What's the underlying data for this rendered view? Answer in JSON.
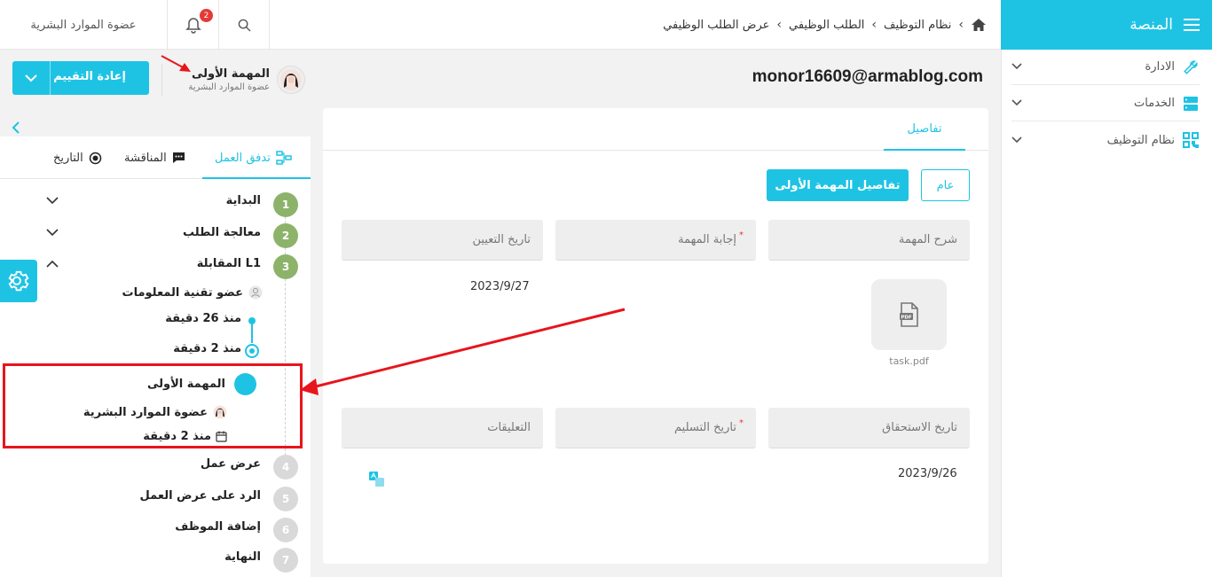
{
  "sidebar": {
    "brand": "المنصة",
    "items": [
      {
        "label": "الادارة",
        "icon": "wrench-icon"
      },
      {
        "label": "الخدمات",
        "icon": "server-icon"
      },
      {
        "label": "نظام التوظيف",
        "icon": "qr-code-icon"
      }
    ]
  },
  "topbar": {
    "breadcrumbs": [
      "نظام التوظيف",
      "الطلب الوظيفي",
      "عرض الطلب الوظيفي"
    ],
    "notification_count": "2",
    "user_role": "عضوة الموارد البشرية"
  },
  "header": {
    "email": "monor16609@armablog.com",
    "reassess_label": "إعادة التقييم",
    "task_title": "المهمة الأولى",
    "task_role": "عضوة الموارد البشرية"
  },
  "card": {
    "tab_details": "تفاصيل",
    "btn_general": "عام",
    "btn_first_task": "تفاصيل المهمة الأولى",
    "fields": {
      "task_description": "شرح المهمة",
      "task_answer": "إجابة المهمة",
      "assign_date": "تاريخ التعيين",
      "due_date": "تاريخ الاستحقاق",
      "delivery_date": "تاريخ التسليم",
      "comments": "التعليقات"
    },
    "assign_date_value": "2023/9/27",
    "file_name": "task.pdf",
    "file_badge": "PDF",
    "due_date_value": "2023/9/26"
  },
  "panel": {
    "tabs": {
      "workflow": "تدفق العمل",
      "discussion": "المناقشة",
      "history": "التاريخ"
    },
    "steps": [
      {
        "num": "1",
        "label": "البداية"
      },
      {
        "num": "2",
        "label": "معالجة الطلب"
      },
      {
        "num": "3",
        "label": "المقابلة L1"
      },
      {
        "num": "4",
        "label": "عرض عمل"
      },
      {
        "num": "5",
        "label": "الرد على عرض العمل"
      },
      {
        "num": "6",
        "label": "إضافة الموظف"
      },
      {
        "num": "7",
        "label": "النهاية"
      }
    ],
    "interview": {
      "member": "عضو تقنية المعلومات",
      "time1": "منذ 26 دقيقة",
      "time2": "منذ 2 دقيقة"
    },
    "subtask": {
      "title": "المهمة الأولى",
      "assignee": "عضوة الموارد البشرية",
      "time": "منذ 2 دقيقة"
    }
  },
  "colors": {
    "accent": "#1ec3e4",
    "done": "#8db36a",
    "pending": "#d9d9d9",
    "annotation": "#e8141c"
  }
}
